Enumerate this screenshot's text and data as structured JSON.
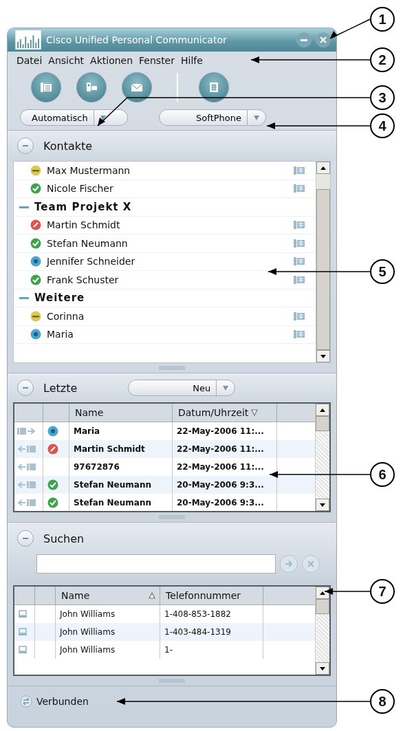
{
  "window": {
    "title": "Cisco Unified Personal Communicator"
  },
  "menu": [
    "Datei",
    "Ansicht",
    "Aktionen",
    "Fenster",
    "Hilfe"
  ],
  "status_dropdown": "Automatisch",
  "device_dropdown": "SoftPhone",
  "contacts": {
    "title": "Kontakte",
    "items": [
      {
        "kind": "contact",
        "name": "Max Mustermann",
        "color": "#d8c95a"
      },
      {
        "kind": "contact",
        "name": "Nicole Fischer",
        "color": "#3fa34d"
      },
      {
        "kind": "group",
        "name": "Team Projekt X",
        "expanded": true,
        "children": [
          {
            "kind": "contact",
            "name": "Martin Schmidt",
            "color": "#d9564f"
          },
          {
            "kind": "contact",
            "name": "Stefan Neumann",
            "color": "#3fa34d"
          },
          {
            "kind": "contact",
            "name": "Jennifer Schneider",
            "color": "#4aa6cf"
          },
          {
            "kind": "contact",
            "name": "Frank Schuster",
            "color": "#3fa34d"
          }
        ]
      },
      {
        "kind": "group",
        "name": "Weitere",
        "expanded": true,
        "children": [
          {
            "kind": "contact",
            "name": "Corinna",
            "color": "#d8c95a"
          },
          {
            "kind": "contact",
            "name": "Maria",
            "color": "#4aa6cf"
          }
        ]
      }
    ]
  },
  "recent": {
    "title": "Letzte",
    "filter": "Neu",
    "columns": [
      {
        "label": "Name",
        "sorted": false
      },
      {
        "label": "Datum/Uhrzeit",
        "sorted": true,
        "descending": true
      }
    ],
    "rows": [
      {
        "outgoing": true,
        "color": "#4aa6cf",
        "name": "Maria",
        "time": "22-May-2006 11:..."
      },
      {
        "outgoing": false,
        "color": "#d9564f",
        "name": "Martin Schmidt",
        "time": "22-May-2006 11:..."
      },
      {
        "outgoing": false,
        "name": "97672876",
        "time": "22-May-2006 11:..."
      },
      {
        "outgoing": false,
        "color": "#3fa34d",
        "name": "Stefan Neumann",
        "time": "20-May-2006 9:3..."
      },
      {
        "outgoing": false,
        "color": "#3fa34d",
        "name": "Stefan Neumann",
        "time": "20-May-2006 9:3..."
      }
    ]
  },
  "search": {
    "title": "Suchen",
    "columns": [
      {
        "label": "Name",
        "sorted": true,
        "descending": false
      },
      {
        "label": "Telefonnummer",
        "sorted": false
      }
    ],
    "rows": [
      {
        "name": "John Williams",
        "phone": "1-408-853-1882"
      },
      {
        "name": "John Williams",
        "phone": "1-403-484-1319"
      },
      {
        "name": "John Williams",
        "phone": "1-"
      }
    ]
  },
  "status_bar": {
    "text": "Verbunden"
  },
  "callouts": [
    "1",
    "2",
    "3",
    "4",
    "5",
    "6",
    "7",
    "8"
  ]
}
